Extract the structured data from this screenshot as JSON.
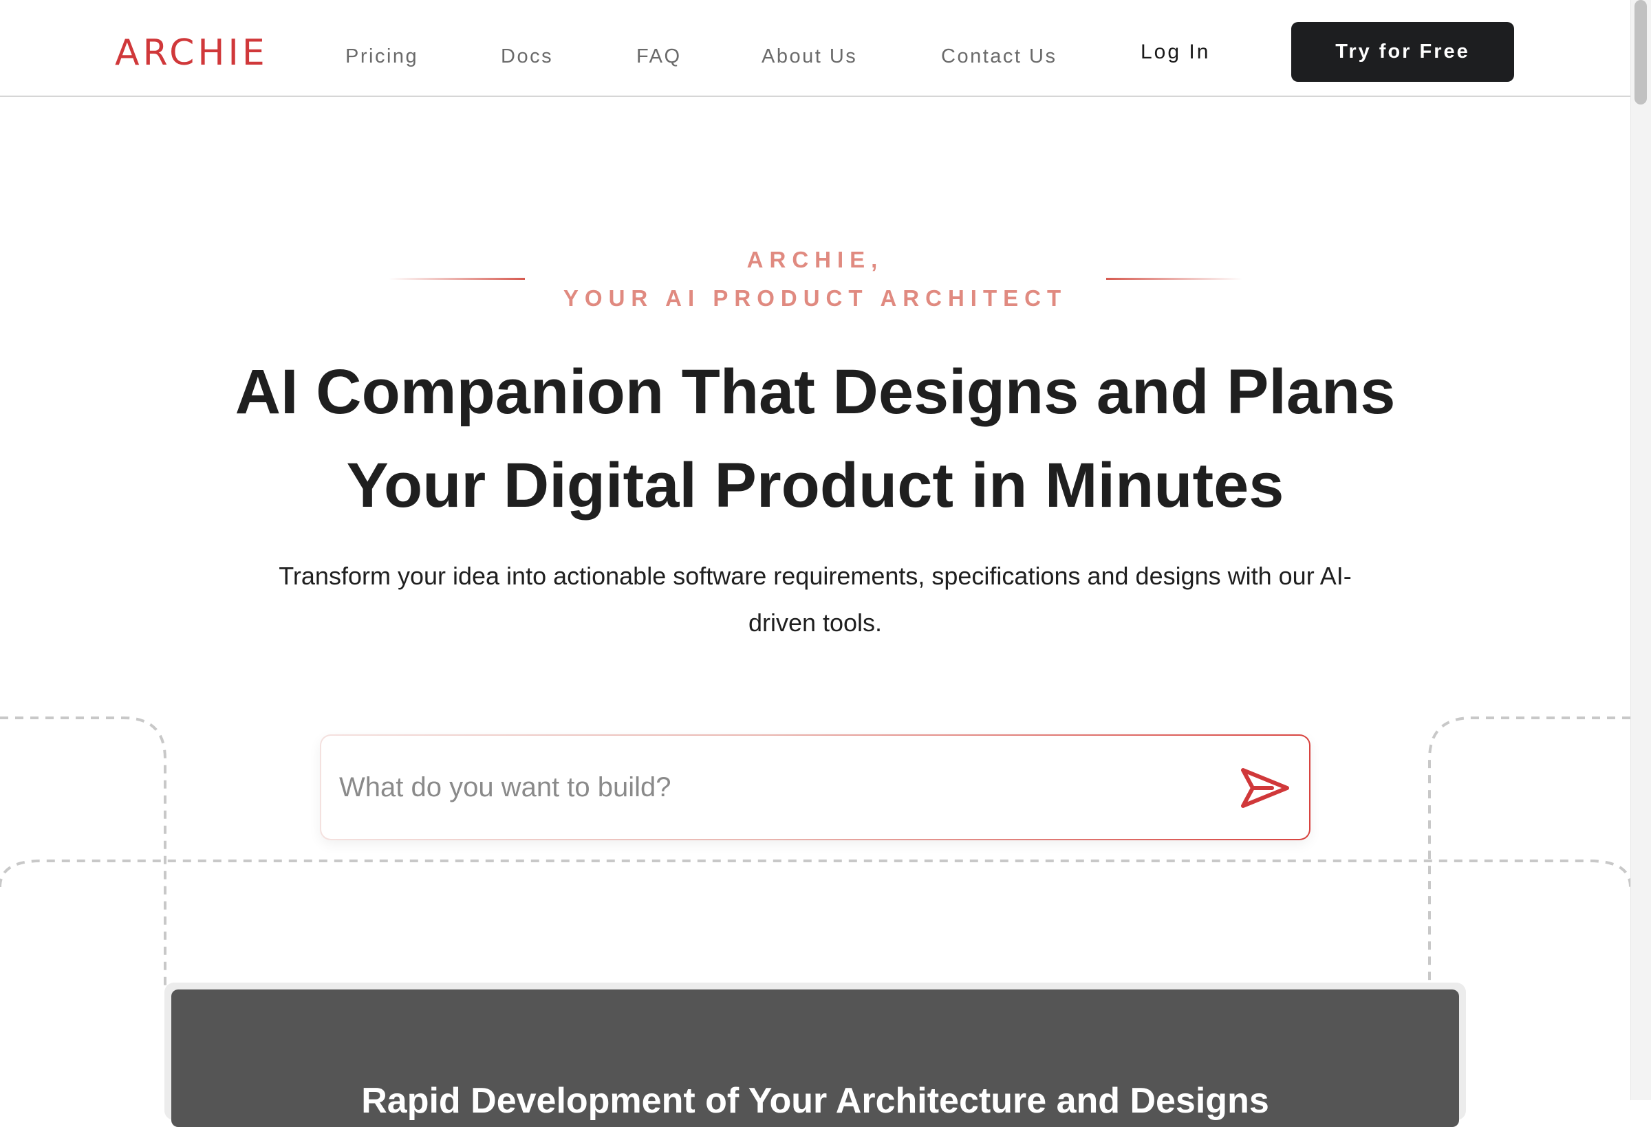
{
  "header": {
    "logo": "ARCHIE",
    "nav": [
      {
        "label": "Pricing"
      },
      {
        "label": "Docs"
      },
      {
        "label": "FAQ"
      },
      {
        "label": "About Us"
      },
      {
        "label": "Contact Us"
      }
    ],
    "login_label": "Log In",
    "cta_label": "Try for Free"
  },
  "hero": {
    "eyebrow_line1": "ARCHIE,",
    "eyebrow_line2": "YOUR AI PRODUCT ARCHITECT",
    "title_line1": "AI Companion That Designs and Plans",
    "title_line2": "Your Digital Product in Minutes",
    "subtitle_line1": "Transform your idea into actionable software requirements, specifications and designs with our AI-",
    "subtitle_line2": "driven tools."
  },
  "prompt": {
    "placeholder": "What do you want to build?",
    "value": "",
    "send_icon": "send-arrow-icon"
  },
  "preview": {
    "title": "Rapid Development of Your Architecture and Designs"
  },
  "colors": {
    "brand": "#d0383a",
    "eyebrow": "#e08a80",
    "cta_bg": "#1d1e20",
    "panel_bg": "#555555"
  }
}
